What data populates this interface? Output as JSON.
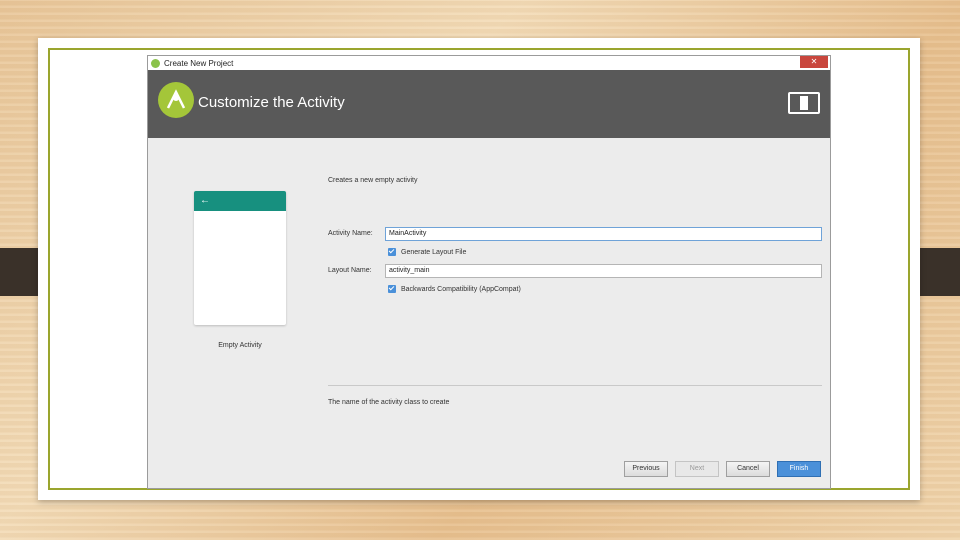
{
  "dialog": {
    "window_title": "Create New Project",
    "header_title": "Customize the Activity",
    "description": "Creates a new empty activity",
    "footer_hint": "The name of the activity class to create"
  },
  "preview": {
    "label": "Empty Activity",
    "back_glyph": "←"
  },
  "form": {
    "activity_name_label": "Activity Name:",
    "activity_name_value": "MainActivity",
    "generate_layout_label": "Generate Layout File",
    "generate_layout_checked": true,
    "layout_name_label": "Layout Name:",
    "layout_name_value": "activity_main",
    "backwards_compat_label": "Backwards Compatibility (AppCompat)",
    "backwards_compat_checked": true
  },
  "buttons": {
    "previous": "Previous",
    "next": "Next",
    "cancel": "Cancel",
    "finish": "Finish"
  },
  "icons": {
    "app": "android-studio-icon",
    "device": "device-preview-icon",
    "close": "close-icon"
  },
  "colors": {
    "header_bg": "#595959",
    "accent_teal": "#17907f",
    "primary_blue": "#4a90d9",
    "slide_frame": "#9aa52e"
  }
}
